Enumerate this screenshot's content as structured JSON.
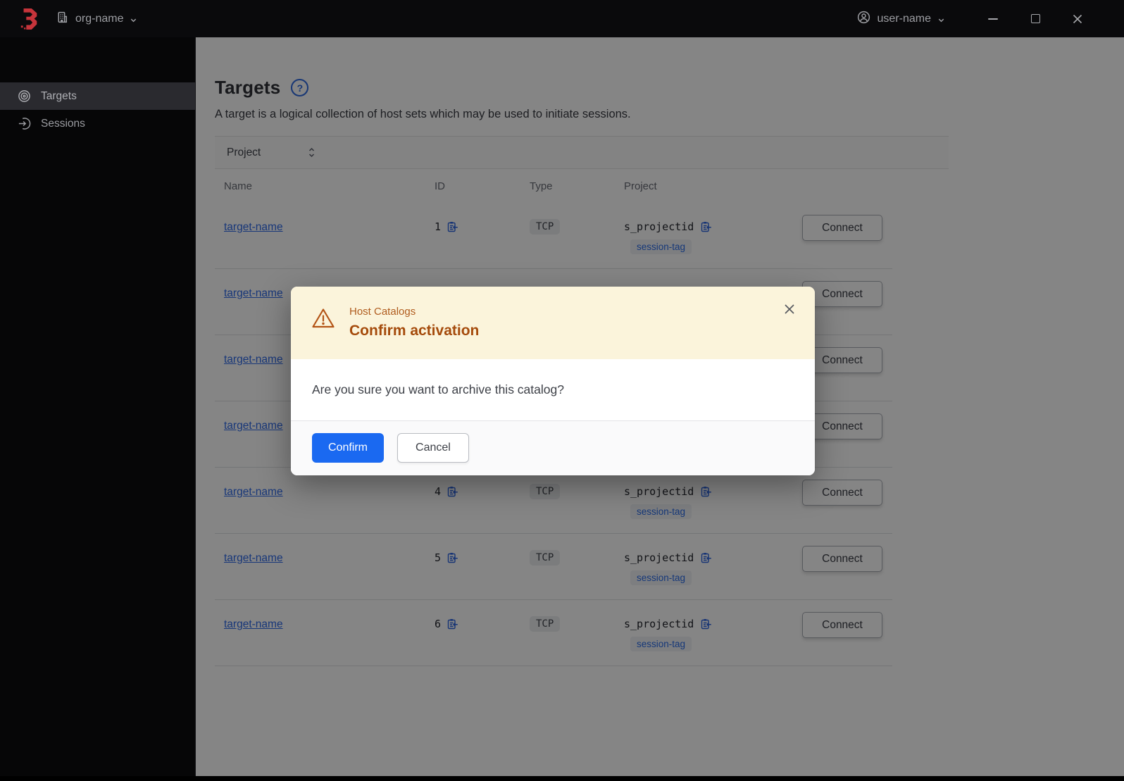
{
  "topbar": {
    "org_label": "org-name",
    "user_label": "user-name"
  },
  "sidebar": {
    "items": [
      {
        "label": "Targets",
        "active": true
      },
      {
        "label": "Sessions",
        "active": false
      }
    ]
  },
  "page": {
    "title": "Targets",
    "help_glyph": "?",
    "description": "A target is a logical collection of host sets which may be used to initiate sessions.",
    "filter_label": "Project",
    "table": {
      "columns": [
        "Name",
        "ID",
        "Type",
        "Project"
      ],
      "connect_label": "Connect",
      "rows": [
        {
          "name": "target-name",
          "id": "1",
          "type": "TCP",
          "project": "s_projectid",
          "tag": "session-tag"
        },
        {
          "name": "target-name",
          "id": "",
          "type": "",
          "project": "",
          "tag": ""
        },
        {
          "name": "target-name",
          "id": "",
          "type": "",
          "project": "",
          "tag": ""
        },
        {
          "name": "target-name",
          "id": "",
          "type": "",
          "project": "",
          "tag": ""
        },
        {
          "name": "target-name",
          "id": "4",
          "type": "TCP",
          "project": "s_projectid",
          "tag": "session-tag"
        },
        {
          "name": "target-name",
          "id": "5",
          "type": "TCP",
          "project": "s_projectid",
          "tag": "session-tag"
        },
        {
          "name": "target-name",
          "id": "6",
          "type": "TCP",
          "project": "s_projectid",
          "tag": "session-tag"
        }
      ]
    }
  },
  "modal": {
    "tagline": "Host Catalogs",
    "title": "Confirm activation",
    "body": "Are you sure you want to archive this catalog?",
    "confirm_label": "Confirm",
    "cancel_label": "Cancel"
  },
  "colors": {
    "accent_blue": "#1a69f1",
    "link_blue": "#2f6ae8",
    "warning_text": "#a54b0c",
    "warning_surface": "#fbf4db",
    "topbar_bg": "#0a0a0c",
    "sidebar_bg": "#060607"
  }
}
